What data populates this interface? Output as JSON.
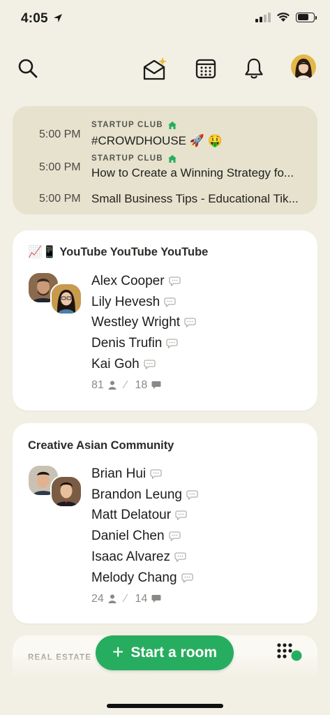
{
  "status_bar": {
    "time": "4:05"
  },
  "toolbar": {
    "icons": [
      "search-icon",
      "invite-envelope-icon",
      "calendar-icon",
      "bell-icon"
    ],
    "accent": "#f2b636"
  },
  "upcoming": [
    {
      "time": "5:00 PM",
      "club": "STARTUP CLUB",
      "title": "#CROWDHOUSE 🚀 🤑"
    },
    {
      "time": "5:00 PM",
      "club": "STARTUP CLUB",
      "title": "How to Create a Winning Strategy fo..."
    },
    {
      "time": "5:00 PM",
      "club": "",
      "title": "Small Business Tips - Educational Tik..."
    }
  ],
  "rooms": [
    {
      "title": "📈📱 YouTube YouTube YouTube",
      "speakers": [
        "Alex Cooper",
        "Lily Hevesh",
        "Westley Wright",
        "Denis Trufin",
        "Kai Goh"
      ],
      "listeners": "81",
      "speakers_count": "18"
    },
    {
      "title": "Creative Asian Community",
      "speakers": [
        "Brian Hui",
        "Brandon Leung",
        "Matt Delatour",
        "Daniel Chen",
        "Isaac Alvarez",
        "Melody Chang"
      ],
      "listeners": "24",
      "speakers_count": "14"
    }
  ],
  "peek": {
    "label": "REAL ESTATE"
  },
  "start_room": {
    "label": "Start a room"
  },
  "colors": {
    "green": "#27ad5f",
    "background": "#f2f0e4",
    "upcoming_bg": "#e6e2ce"
  }
}
